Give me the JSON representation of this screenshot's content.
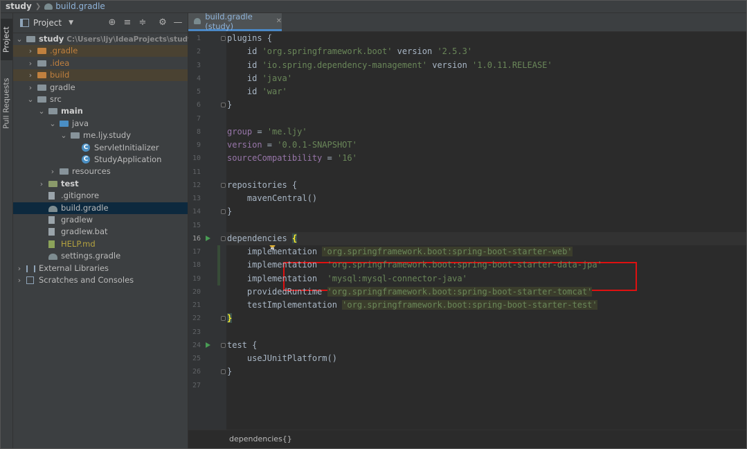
{
  "breadcrumb": {
    "project": "study",
    "file": "build.gradle"
  },
  "tool_strip": {
    "project_label": "Project",
    "pull_requests_label": "Pull Requests"
  },
  "project_panel": {
    "title": "Project",
    "tree": [
      {
        "label": "study",
        "path": "C:\\Users\\ljy\\IdeaProjects\\study",
        "kind": "root"
      },
      {
        "label": ".gradle",
        "kind": "folder-excluded"
      },
      {
        "label": ".idea",
        "kind": "folder"
      },
      {
        "label": "build",
        "kind": "folder-excluded"
      },
      {
        "label": "gradle",
        "kind": "folder"
      },
      {
        "label": "src",
        "kind": "folder"
      },
      {
        "label": "main",
        "kind": "folder"
      },
      {
        "label": "java",
        "kind": "folder"
      },
      {
        "label": "me.ljy.study",
        "kind": "package"
      },
      {
        "label": "ServletInitializer",
        "kind": "class"
      },
      {
        "label": "StudyApplication",
        "kind": "class"
      },
      {
        "label": "resources",
        "kind": "folder"
      },
      {
        "label": "test",
        "kind": "folder"
      },
      {
        "label": ".gitignore",
        "kind": "file"
      },
      {
        "label": "build.gradle",
        "kind": "gradle-file"
      },
      {
        "label": "gradlew",
        "kind": "file"
      },
      {
        "label": "gradlew.bat",
        "kind": "file"
      },
      {
        "label": "HELP.md",
        "kind": "md-file"
      },
      {
        "label": "settings.gradle",
        "kind": "gradle-file"
      },
      {
        "label": "External Libraries",
        "kind": "libraries"
      },
      {
        "label": "Scratches and Consoles",
        "kind": "scratches"
      }
    ]
  },
  "editor": {
    "tab_label": "build.gradle (study)",
    "line_numbers": [
      "1",
      "2",
      "3",
      "4",
      "5",
      "6",
      "7",
      "8",
      "9",
      "10",
      "11",
      "12",
      "13",
      "14",
      "15",
      "16",
      "17",
      "18",
      "19",
      "20",
      "21",
      "22",
      "23",
      "24",
      "25",
      "26",
      "27"
    ],
    "lines": [
      [
        {
          "t": "plugins {",
          "c": "kw"
        }
      ],
      [
        {
          "t": "    id ",
          "c": "kw"
        },
        {
          "t": "'org.springframework.boot'",
          "c": "str"
        },
        {
          "t": " version ",
          "c": "kw"
        },
        {
          "t": "'2.5.3'",
          "c": "str"
        }
      ],
      [
        {
          "t": "    id ",
          "c": "kw"
        },
        {
          "t": "'io.spring.dependency-management'",
          "c": "str"
        },
        {
          "t": " version ",
          "c": "kw"
        },
        {
          "t": "'1.0.11.RELEASE'",
          "c": "str"
        }
      ],
      [
        {
          "t": "    id ",
          "c": "kw"
        },
        {
          "t": "'java'",
          "c": "str"
        }
      ],
      [
        {
          "t": "    id ",
          "c": "kw"
        },
        {
          "t": "'war'",
          "c": "str"
        }
      ],
      [
        {
          "t": "}",
          "c": "kw"
        }
      ],
      [],
      [
        {
          "t": "group",
          "c": "var"
        },
        {
          "t": " = ",
          "c": "kw"
        },
        {
          "t": "'me.ljy'",
          "c": "str"
        }
      ],
      [
        {
          "t": "version",
          "c": "var"
        },
        {
          "t": " = ",
          "c": "kw"
        },
        {
          "t": "'0.0.1-SNAPSHOT'",
          "c": "str"
        }
      ],
      [
        {
          "t": "sourceCompatibility",
          "c": "var"
        },
        {
          "t": " = ",
          "c": "kw"
        },
        {
          "t": "'16'",
          "c": "str"
        }
      ],
      [],
      [
        {
          "t": "repositories {",
          "c": "kw"
        }
      ],
      [
        {
          "t": "    mavenCentral()",
          "c": "kw"
        }
      ],
      [
        {
          "t": "}",
          "c": "kw"
        }
      ],
      [],
      [
        {
          "t": "dependencies ",
          "c": "kw"
        },
        {
          "t": "{",
          "c": "brace-hl"
        }
      ],
      [
        {
          "t": "    implementation ",
          "c": "kw"
        },
        {
          "t": "'org.springframework.boot:spring-boot-starter-web'",
          "c": "strhl"
        }
      ],
      [
        {
          "t": "    implementation  ",
          "c": "kw"
        },
        {
          "t": "'org.springframework.boot:spring-boot-starter-data-jpa'",
          "c": "str"
        }
      ],
      [
        {
          "t": "    implementation  ",
          "c": "kw"
        },
        {
          "t": "'mysql:mysql-connector-java'",
          "c": "str"
        }
      ],
      [
        {
          "t": "    providedRuntime ",
          "c": "kw"
        },
        {
          "t": "'org.springframework.boot:spring-boot-starter-tomcat'",
          "c": "strhl"
        }
      ],
      [
        {
          "t": "    testImplementation ",
          "c": "kw"
        },
        {
          "t": "'org.springframework.boot:spring-boot-starter-test'",
          "c": "strhl"
        }
      ],
      [
        {
          "t": "}",
          "c": "brace-hl"
        }
      ],
      [],
      [
        {
          "t": "test {",
          "c": "kw"
        }
      ],
      [
        {
          "t": "    useJUnitPlatform()",
          "c": "kw"
        }
      ],
      [
        {
          "t": "}",
          "c": "kw"
        }
      ],
      []
    ],
    "status_breadcrumb": "dependencies{}"
  },
  "colors": {
    "selection": "#0d293e",
    "highlight_box": "#e01010",
    "run_icon": "#499c54",
    "string": "#6a8759"
  }
}
